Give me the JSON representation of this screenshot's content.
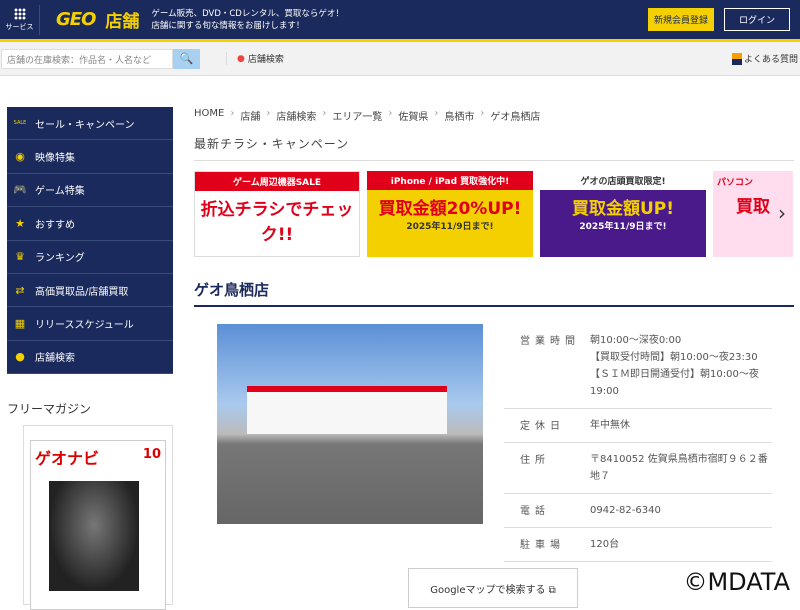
{
  "header": {
    "service_label": "サービス",
    "logo": "GEO",
    "section": "店舗",
    "tagline1": "ゲーム販売、DVD・CDレンタル、買取ならゲオ！",
    "tagline2": "店舗に関する旬な情報をお届けします！",
    "register": "新規会員登録",
    "login": "ログイン"
  },
  "searchbar": {
    "placeholder": "店舗の在庫検索：作品名・人名など",
    "store_search": "店舗検索",
    "faq": "よくある質問"
  },
  "sidebar": {
    "items": [
      {
        "icon": "sale-icon",
        "label": "セール・キャンペーン"
      },
      {
        "icon": "film-icon",
        "label": "映像特集"
      },
      {
        "icon": "gamepad-icon",
        "label": "ゲーム特集"
      },
      {
        "icon": "star-icon",
        "label": "おすすめ"
      },
      {
        "icon": "crown-icon",
        "label": "ランキング"
      },
      {
        "icon": "exchange-icon",
        "label": "高価買取品/店舗買取"
      },
      {
        "icon": "calendar-icon",
        "label": "リリーススケジュール"
      },
      {
        "icon": "pin-icon",
        "label": "店舗検索"
      }
    ],
    "magazine_title": "フリーマガジン",
    "magazine_name": "ゲオナビ",
    "magazine_issue": "10"
  },
  "breadcrumb": [
    "HOME",
    "店舗",
    "店舗検索",
    "エリア一覧",
    "佐賀県",
    "鳥栖市",
    "ゲオ鳥栖店"
  ],
  "campaign_heading": "最新チラシ・キャンペーン",
  "banners": [
    {
      "top": "ゲーム周辺機器SALE",
      "main": "折込チラシでチェック!!"
    },
    {
      "top": "iPhone / iPad 買取強化中!",
      "main": "買取金額20%UP!",
      "sub": "2025年11/9日まで!"
    },
    {
      "top": "ゲオの店頭買取限定!",
      "main": "買取金額UP!",
      "sub": "2025年11/9日まで!"
    },
    {
      "top": "パソコン",
      "main": "買取"
    }
  ],
  "store": {
    "name": "ゲオ鳥栖店",
    "info": [
      {
        "label": "営業時間",
        "value": [
          "朝10:00〜深夜0:00",
          "【買取受付時間】朝10:00〜夜23:30",
          "【ＳＩＭ即日開通受付】朝10:00〜夜19:00"
        ]
      },
      {
        "label": "定休日",
        "value": [
          "年中無休"
        ]
      },
      {
        "label": "住所",
        "value": [
          "〒8410052 佐賀県鳥栖市宿町９６２番地７"
        ]
      },
      {
        "label": "電話",
        "value": [
          "0942-82-6340"
        ]
      },
      {
        "label": "駐車場",
        "value": [
          "120台"
        ]
      }
    ],
    "map_button": "Googleマップで検索する"
  },
  "watermark": "©MDATA"
}
